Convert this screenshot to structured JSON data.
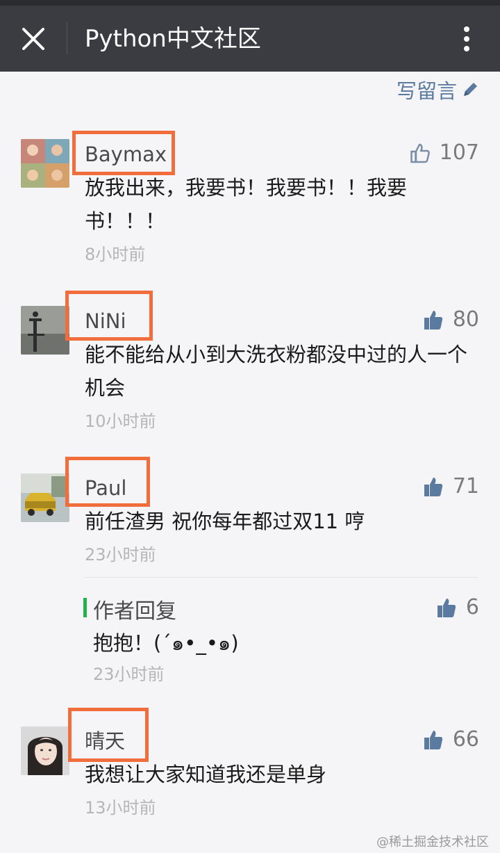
{
  "header": {
    "title": "Python中文社区",
    "close_icon": "close-icon",
    "more_icon": "more-vertical-icon",
    "background": "#3a3c41"
  },
  "write_comment": {
    "label": "写留言",
    "icon": "pencil-icon",
    "color": "#5b7aa0"
  },
  "accent": {
    "highlight_box": "#f26d3c",
    "reply_bar": "#21b34a",
    "liked": "#5b7aa0"
  },
  "comments": [
    {
      "name": "Baymax",
      "avatar": "photo-collage-avatar",
      "likes": "107",
      "like_icon": "thumbs-up-outline-icon",
      "content": "放我出来，我要书！我要书！！我要书！！！",
      "time": "8小时前"
    },
    {
      "name": "NiNi",
      "avatar": "lamp-post-avatar",
      "likes": "80",
      "like_icon": "thumbs-up-filled-icon",
      "content": "能不能给从小到大洗衣粉都没中过的人一个机会",
      "time": "10小时前"
    },
    {
      "name": "Paul",
      "avatar": "taxi-avatar",
      "likes": "71",
      "like_icon": "thumbs-up-filled-icon",
      "content": "前任渣男 祝你每年都过双11 哼",
      "time": "23小时前",
      "reply": {
        "label": "作者回复",
        "likes": "6",
        "content": "抱抱！(´๑•_•๑)",
        "time": "23小时前"
      }
    },
    {
      "name": "晴天",
      "avatar": "woman-portrait-avatar",
      "likes": "66",
      "like_icon": "thumbs-up-filled-icon",
      "content": "我想让大家知道我还是单身",
      "time": "13小时前"
    }
  ],
  "watermark": "@稀土掘金技术社区"
}
